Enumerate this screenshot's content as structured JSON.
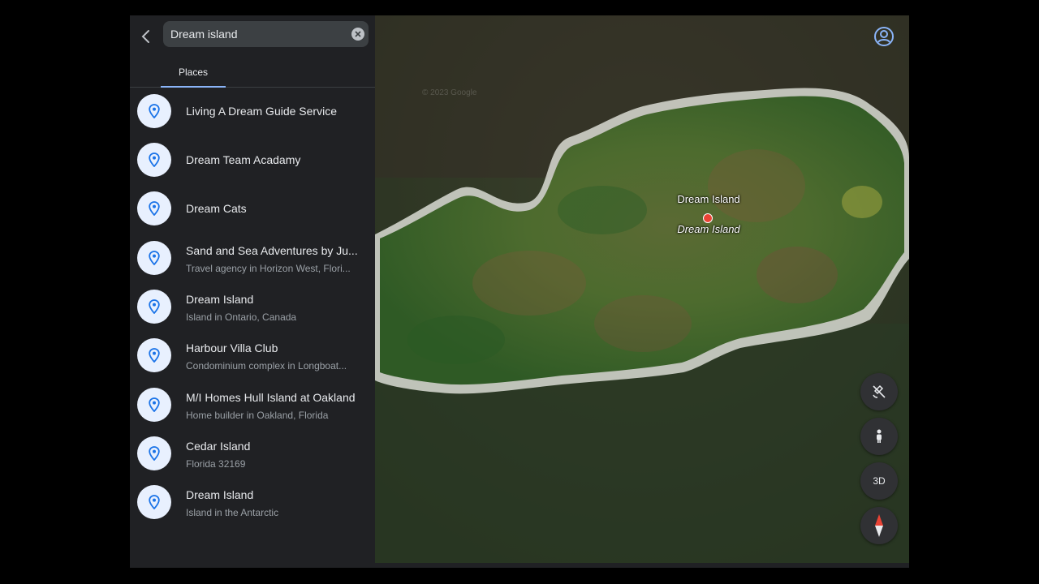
{
  "search": {
    "value": "Dream island"
  },
  "tabs": [
    {
      "label": "Places"
    }
  ],
  "results": [
    {
      "title": "Living A Dream Guide Service",
      "subtitle": ""
    },
    {
      "title": "Dream Team Acadamy",
      "subtitle": ""
    },
    {
      "title": "Dream Cats",
      "subtitle": ""
    },
    {
      "title": "Sand and Sea Adventures by Ju...",
      "subtitle": "Travel agency in Horizon West, Flori..."
    },
    {
      "title": "Dream Island",
      "subtitle": "Island in Ontario, Canada"
    },
    {
      "title": "Harbour Villa Club",
      "subtitle": "Condominium complex in Longboat..."
    },
    {
      "title": "M/I Homes Hull Island at Oakland",
      "subtitle": "Home builder in Oakland, Florida"
    },
    {
      "title": "Cedar Island",
      "subtitle": "Florida 32169"
    },
    {
      "title": "Dream Island",
      "subtitle": "Island in the Antarctic"
    }
  ],
  "map": {
    "watermark": "© 2023 Google",
    "place_label": "Dream Island",
    "place_label_italic": "Dream Island",
    "controls": {
      "three_d_label": "3D"
    }
  },
  "icons": {
    "back": "chevron-left-icon",
    "clear": "close-icon",
    "result_pin": "location-pin-icon",
    "account": "account-circle-icon",
    "imagery": "satellite-off-icon",
    "pegman": "pegman-icon",
    "compass": "compass-icon"
  },
  "colors": {
    "accent": "#8ab4f8",
    "pin": "#1a73e8",
    "marker": "#ea4335",
    "panel": "#202124"
  }
}
